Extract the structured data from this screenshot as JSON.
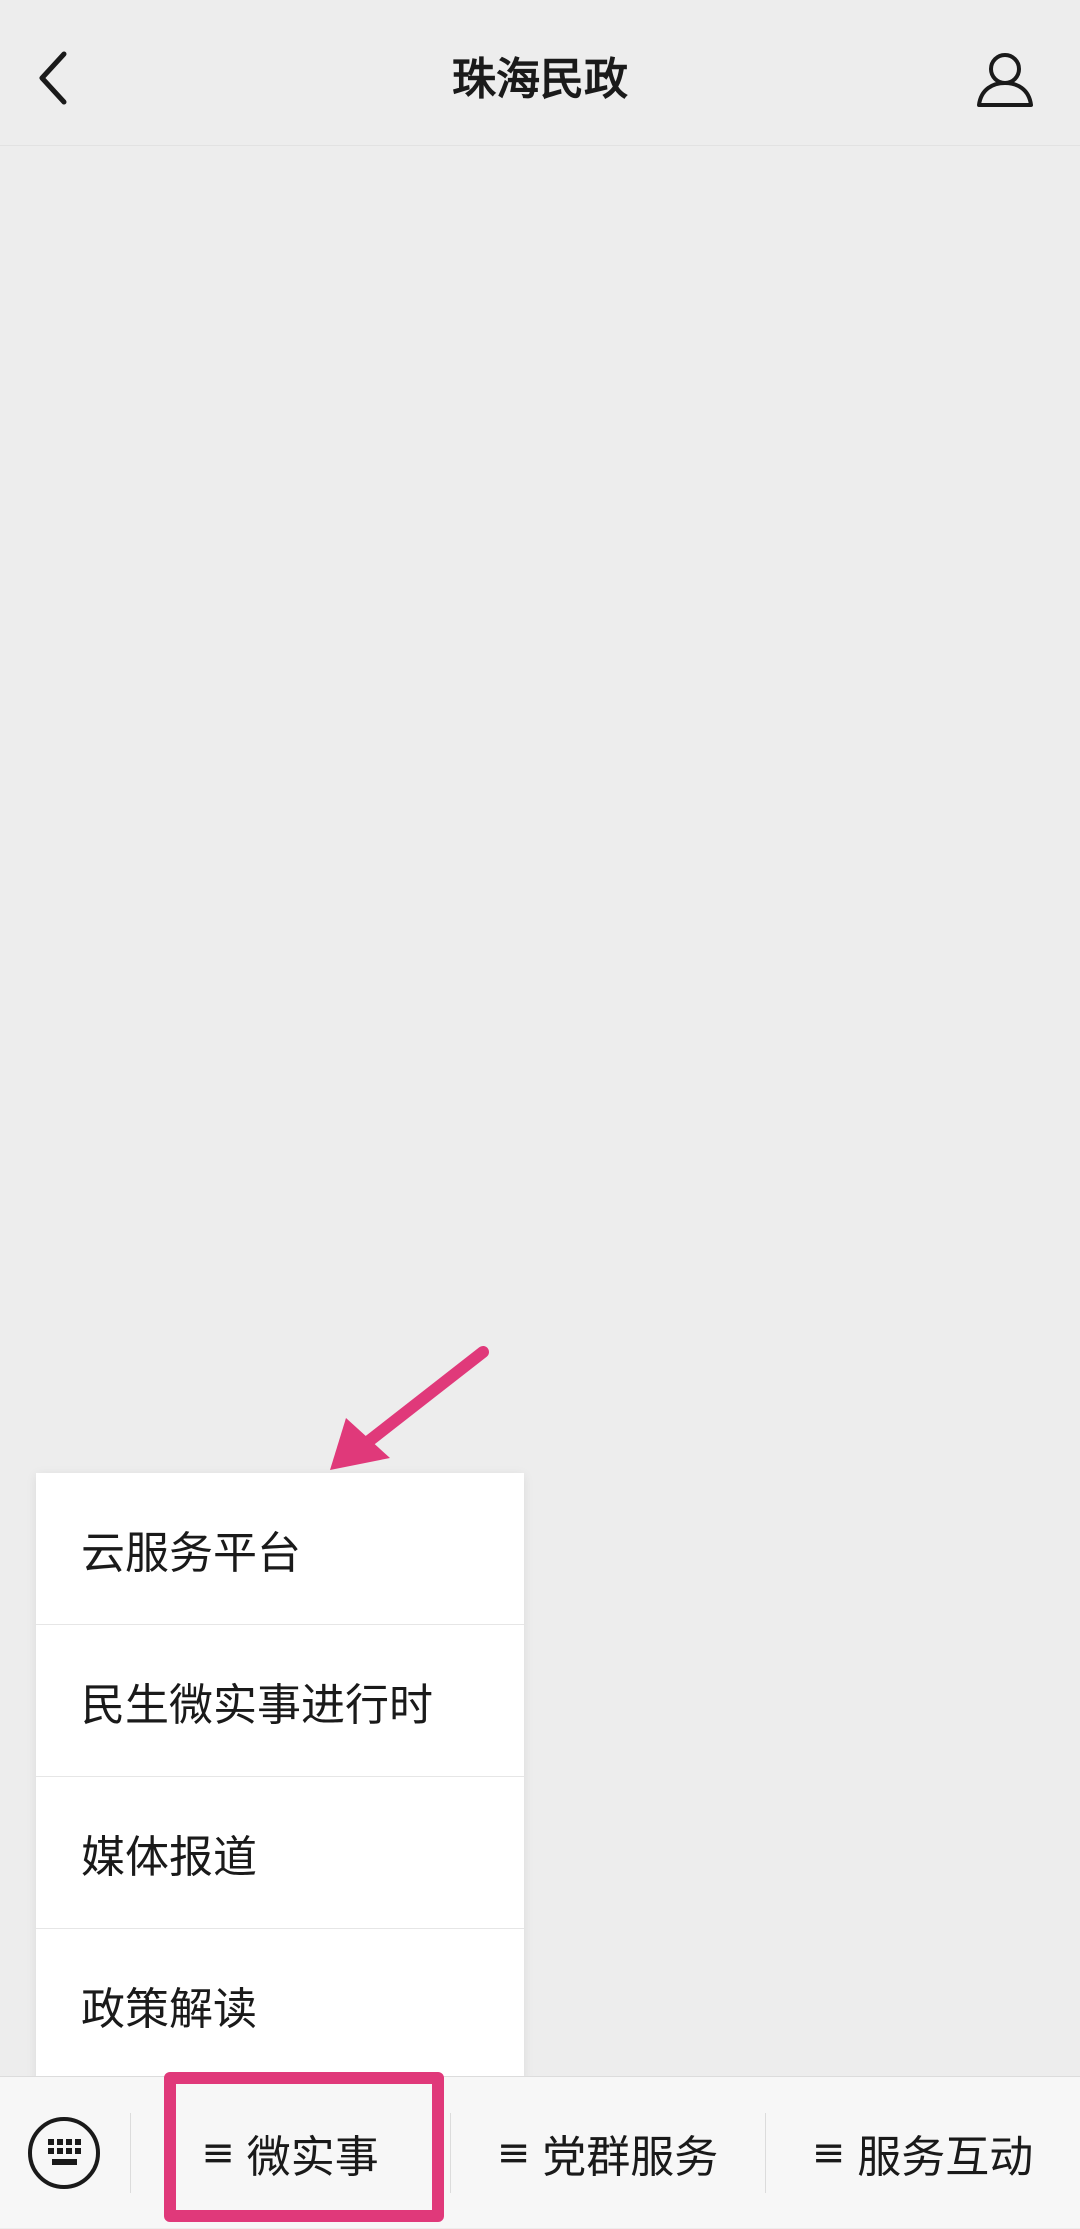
{
  "header": {
    "title": "珠海民政",
    "back_icon": "chevron-left-icon",
    "profile_icon": "person-icon"
  },
  "popup_menu": {
    "items": [
      {
        "label": "云服务平台"
      },
      {
        "label": "民生微实事进行时"
      },
      {
        "label": "媒体报道"
      },
      {
        "label": "政策解读"
      }
    ]
  },
  "bottom_menu": {
    "keyboard_icon": "keyboard-icon",
    "tabs": [
      {
        "icon": "≡",
        "label": "微实事"
      },
      {
        "icon": "≡",
        "label": "党群服务"
      },
      {
        "icon": "≡",
        "label": "服务互动"
      }
    ]
  },
  "annotation": {
    "color": "#e0397a"
  }
}
